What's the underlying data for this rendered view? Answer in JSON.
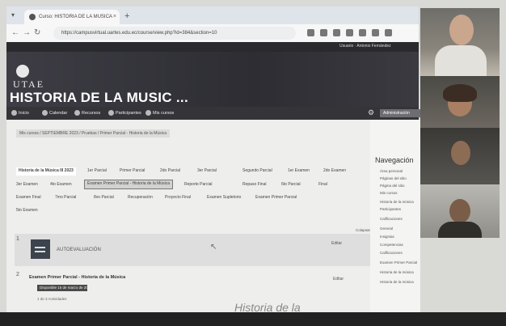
{
  "browser": {
    "tab_title": "Curso: HISTORIA DE LA MUSICA",
    "tab_close": "×",
    "new_tab": "+",
    "url": "https://campusvirtual.uartes.edu.ec/course/view.php?id=384&section=10"
  },
  "header": {
    "user": "Usuario · Antonio Fernández",
    "logo_text": "UTAE",
    "course_title": "HISTORIA DE LA MUSIC ..."
  },
  "menu": {
    "items": [
      "Inicio",
      "Calendar",
      "Recursos",
      "Participantes",
      "Mis cursos"
    ],
    "admin_label": "Administración"
  },
  "breadcrumb": "Mis cursos / SEPTIEMBRE 2023 / Pruebas / Primer Parcial - Historia de la Música",
  "course_tabs": [
    "Historia de la Música III 2023",
    "1er Parcial",
    "Primer Parcial",
    "2do Parcial",
    "3er Parcial",
    "Segundo Parcial",
    "1er Examen",
    "2do Examen",
    "3er Examen",
    "4to Examen",
    "5to Examen",
    "Examen Primer Parcial - Historia de la Música",
    "Reporte Parcial",
    "Repaso Final",
    "6to Parcial",
    "Final",
    "Examen Final",
    "7mo Parcial",
    "8vo Parcial",
    "Recuperación",
    "Proyecto Final",
    "Examen Supletorio",
    "Examen Primer Parcial"
  ],
  "sections": {
    "s1_num": "1",
    "autoevaluacion": "AUTOEVALUACIÓN",
    "edit_label": "Editar",
    "collapse": "Colapsar todo",
    "s2_num": "2",
    "s2_title": "Examen Primer Parcial - Historia de la Música",
    "s2_badge": "Disponible 15 de marzo de 2024",
    "s2_line": "1 de 3 Actividades",
    "s2_edit": "Editar"
  },
  "navigation": {
    "title": "Navegación",
    "items": [
      "Área personal",
      "Páginas del sitio",
      "Página del sitio",
      "Mis cursos",
      "Historia de la música",
      "Participantes",
      "Calificaciones",
      "General",
      "Insignias",
      "Competencias",
      "Calificaciones",
      "Examen Primer Parcial",
      "Historia de la música",
      "Historia de la música"
    ]
  },
  "cursor": "↖",
  "scribble": "Historia de la"
}
